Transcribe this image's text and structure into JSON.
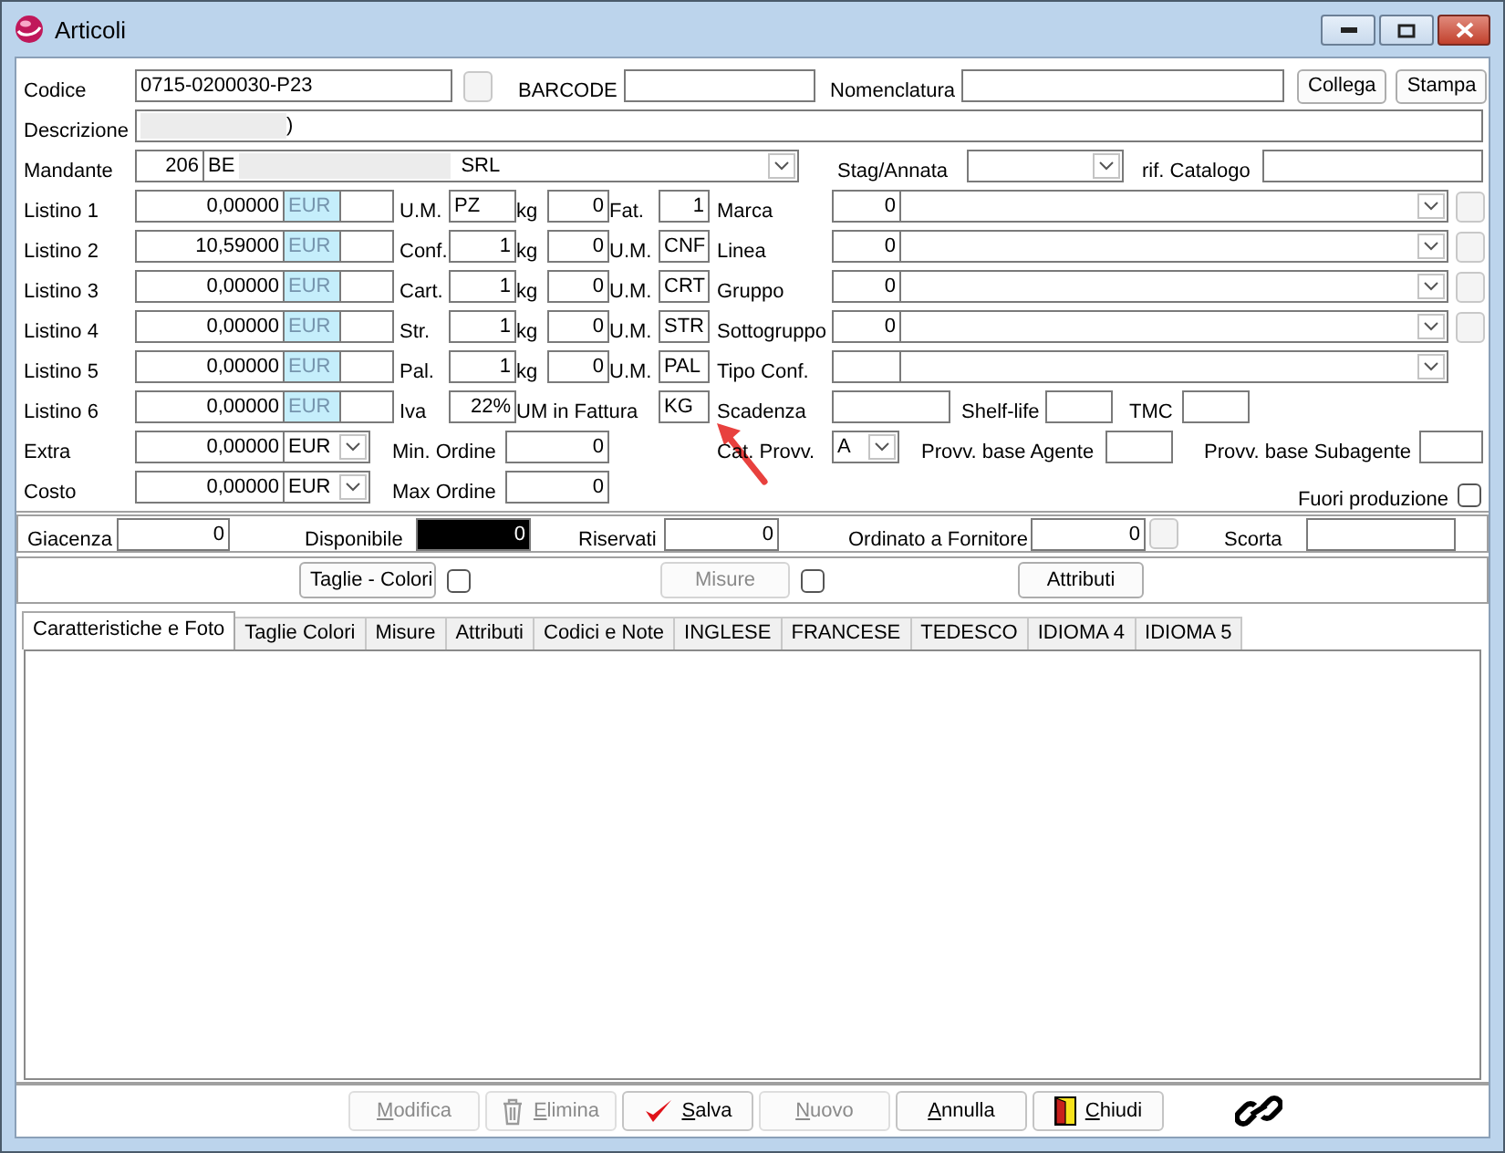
{
  "window": {
    "title": "Articoli"
  },
  "codice": {
    "label": "Codice",
    "value": "0715-0200030-P23"
  },
  "barcode": {
    "label": "BARCODE"
  },
  "nomenclatura": {
    "label": "Nomenclatura"
  },
  "header_buttons": [
    "Collega",
    "Stampa"
  ],
  "descrizione": {
    "label": "Descrizione",
    "value": ")"
  },
  "mandante": {
    "label": "Mandante",
    "code": "206",
    "name_start": "BE",
    "name_end": "SRL"
  },
  "stag_annata": {
    "label": "Stag/Annata"
  },
  "rif_catalogo": {
    "label": "rif. Catalogo"
  },
  "listini": [
    {
      "label": "Listino 1",
      "value": "0,00000",
      "currency": "EUR"
    },
    {
      "label": "Listino 2",
      "value": "10,59000",
      "currency": "EUR"
    },
    {
      "label": "Listino 3",
      "value": "0,00000",
      "currency": "EUR"
    },
    {
      "label": "Listino 4",
      "value": "0,00000",
      "currency": "EUR"
    },
    {
      "label": "Listino 5",
      "value": "0,00000",
      "currency": "EUR"
    },
    {
      "label": "Listino 6",
      "value": "0,00000",
      "currency": "EUR"
    }
  ],
  "packaging": [
    {
      "label": "U.M.",
      "value": "PZ",
      "kg_label": "kg",
      "kg": "0",
      "unit_label": "Fat.",
      "unit": "1"
    },
    {
      "label": "Conf.",
      "value": "1",
      "kg_label": "kg",
      "kg": "0",
      "unit_label": "U.M.",
      "unit": "CNF"
    },
    {
      "label": "Cart.",
      "value": "1",
      "kg_label": "kg",
      "kg": "0",
      "unit_label": "U.M.",
      "unit": "CRT"
    },
    {
      "label": "Str.",
      "value": "1",
      "kg_label": "kg",
      "kg": "0",
      "unit_label": "U.M.",
      "unit": "STR"
    },
    {
      "label": "Pal.",
      "value": "1",
      "kg_label": "kg",
      "kg": "0",
      "unit_label": "U.M.",
      "unit": "PAL"
    },
    {
      "label": "Iva",
      "value": "22%",
      "unit_label": "UM in Fattura",
      "unit": "KG"
    }
  ],
  "classifications": [
    {
      "label": "Marca",
      "code": "0",
      "has_button": true
    },
    {
      "label": "Linea",
      "code": "0",
      "has_button": true
    },
    {
      "label": "Gruppo",
      "code": "0",
      "has_button": true
    },
    {
      "label": "Sottogruppo",
      "code": "0",
      "has_button": true
    },
    {
      "label": "Tipo Conf.",
      "has_button": false
    }
  ],
  "scadenza": {
    "label": "Scadenza"
  },
  "shelf_life": {
    "label": "Shelf-life"
  },
  "tmc": {
    "label": "TMC"
  },
  "extra": {
    "label": "Extra",
    "value": "0,00000",
    "currency": "EUR"
  },
  "costo": {
    "label": "Costo",
    "value": "0,00000",
    "currency": "EUR"
  },
  "min_ordine": {
    "label": "Min. Ordine",
    "value": "0"
  },
  "max_ordine": {
    "label": "Max Ordine",
    "value": "0"
  },
  "cat_provv": {
    "label": "Cat. Provv.",
    "value": "A"
  },
  "provv_agente": {
    "label": "Provv. base Agente"
  },
  "provv_subagente": {
    "label": "Provv. base Subagente"
  },
  "fuori_produzione": {
    "label": "Fuori produzione",
    "checked": false
  },
  "stock": [
    {
      "label": "Giacenza",
      "value": "0",
      "kind": "plain"
    },
    {
      "label": "Disponibile",
      "value": "0",
      "kind": "dark"
    },
    {
      "label": "Riservati",
      "value": "0",
      "kind": "plain"
    },
    {
      "label": "Ordinato a Fornitore",
      "value": "0",
      "kind": "button"
    },
    {
      "label": "Scorta",
      "kind": "plain"
    }
  ],
  "section_buttons": [
    {
      "label": "Taglie - Colori",
      "disabled": false,
      "checked": false
    },
    {
      "label": "Misure",
      "disabled": true,
      "checked": false
    },
    {
      "label": "Attributi",
      "disabled": false
    }
  ],
  "tabs": [
    {
      "label": "Caratteristiche e Foto",
      "selected": true
    },
    {
      "label": "Taglie Colori",
      "selected": false
    },
    {
      "label": "Misure",
      "selected": false
    },
    {
      "label": "Attributi",
      "selected": false
    },
    {
      "label": "Codici e Note",
      "selected": false
    },
    {
      "label": "INGLESE",
      "selected": false
    },
    {
      "label": "FRANCESE",
      "selected": false
    },
    {
      "label": "TEDESCO",
      "selected": false
    },
    {
      "label": "IDIOMA 4",
      "selected": false
    },
    {
      "label": "IDIOMA 5",
      "selected": false
    }
  ],
  "footer_buttons": [
    {
      "label": "Modifica",
      "disabled": true
    },
    {
      "label": "Elimina",
      "disabled": true,
      "kind": "trash"
    },
    {
      "label": "Salva",
      "disabled": false,
      "kind": "check"
    },
    {
      "label": "Nuovo",
      "disabled": true
    },
    {
      "label": "Annulla",
      "disabled": false
    },
    {
      "label": "Chiudi",
      "disabled": false,
      "kind": "door"
    }
  ]
}
